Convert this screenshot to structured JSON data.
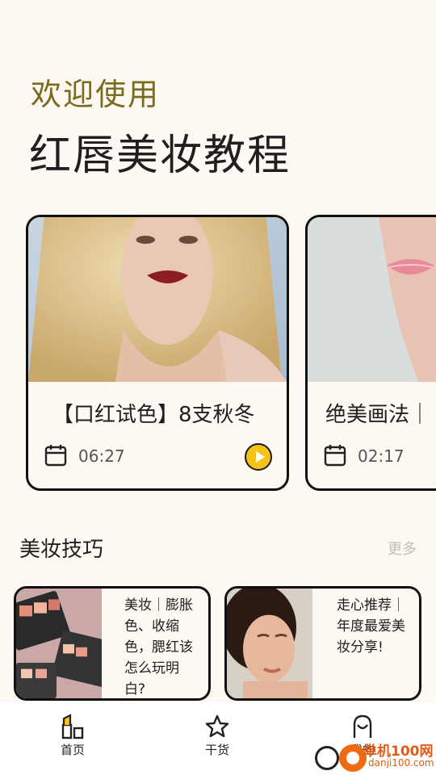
{
  "header": {
    "welcome": "欢迎使用",
    "app_title": "红唇美妆教程"
  },
  "videos": [
    {
      "title": "【口红试色】8支秋冬",
      "duration": "06:27",
      "thumb_icon": "blonde-woman-red-lips-photo"
    },
    {
      "title": "绝美画法｜",
      "duration": "02:17",
      "thumb_icon": "pink-lips-closeup-photo"
    }
  ],
  "tips_section": {
    "title": "美妆技巧",
    "more_label": "更多",
    "items": [
      {
        "text": "美妆｜膨胀色、收缩色，腮红该怎么玩明白?",
        "image_icon": "eyeshadow-palettes-photo"
      },
      {
        "text": "走心推荐｜年度最爱美妆分享!",
        "image_icon": "curly-hair-woman-photo"
      }
    ]
  },
  "bottom_nav": {
    "items": [
      {
        "label": "首页",
        "icon": "lipstick-icon"
      },
      {
        "label": "干货",
        "icon": "star-icon"
      },
      {
        "label": "我的",
        "icon": "profile-icon"
      }
    ]
  },
  "watermark": {
    "name": "单机100网",
    "url": "danji100.com"
  },
  "colors": {
    "background": "#fdf8f2",
    "accent_gold": "#7a6b1f",
    "play_yellow": "#f5c218"
  }
}
